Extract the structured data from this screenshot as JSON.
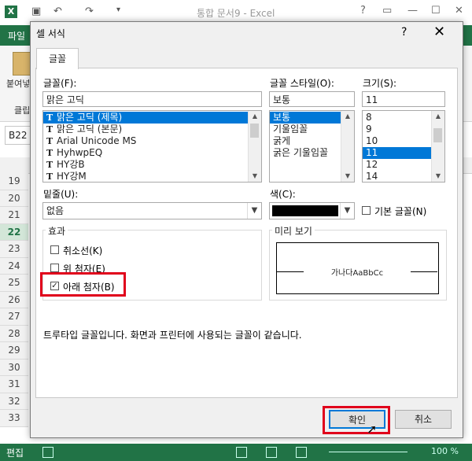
{
  "excel": {
    "window_title": "통합 문서9 - Excel",
    "file_tab": "파일",
    "paste_label": "붙여넣",
    "clipboard_label": "클립",
    "name_box": "B22",
    "row_numbers": [
      "19",
      "20",
      "21",
      "22",
      "23",
      "24",
      "25",
      "26",
      "27",
      "28",
      "29",
      "30",
      "31",
      "32",
      "33"
    ],
    "active_row": "22",
    "status_mode": "편집",
    "zoom": "100 %",
    "accent_color": "#217346"
  },
  "dialog": {
    "title": "셀 서식",
    "help": "?",
    "close": "✕",
    "tab_font": "글꼴",
    "font_label": "글꼴(F):",
    "font_value": "맑은 고딕",
    "font_list": [
      "맑은 고딕 (제목)",
      "맑은 고딕 (본문)",
      "Arial Unicode MS",
      "HyhwpEQ",
      "HY강B",
      "HY강M"
    ],
    "font_style_label": "글꼴 스타일(O):",
    "font_style_value": "보통",
    "font_style_list": [
      "보통",
      "기울임꼴",
      "굵게",
      "굵은 기울임꼴"
    ],
    "size_label": "크기(S):",
    "size_value": "11",
    "size_list": [
      "8",
      "9",
      "10",
      "11",
      "12",
      "14"
    ],
    "underline_label": "밑줄(U):",
    "underline_value": "없음",
    "color_label": "색(C):",
    "default_font_label": "기본 글꼴(N)",
    "effects_label": "효과",
    "strikethrough_label": "취소선(K)",
    "superscript_label": "위 첨자(E)",
    "subscript_label": "아래 첨자(B)",
    "subscript_checked": true,
    "preview_label": "미리 보기",
    "preview_text": "가나다AaBbCc",
    "info_text": "트루타입 글꼴입니다. 화면과 프린터에 사용되는 글꼴이 같습니다.",
    "ok_label": "확인",
    "cancel_label": "취소",
    "selected_color": "#0078d7",
    "highlight_color": "#e0001b"
  }
}
